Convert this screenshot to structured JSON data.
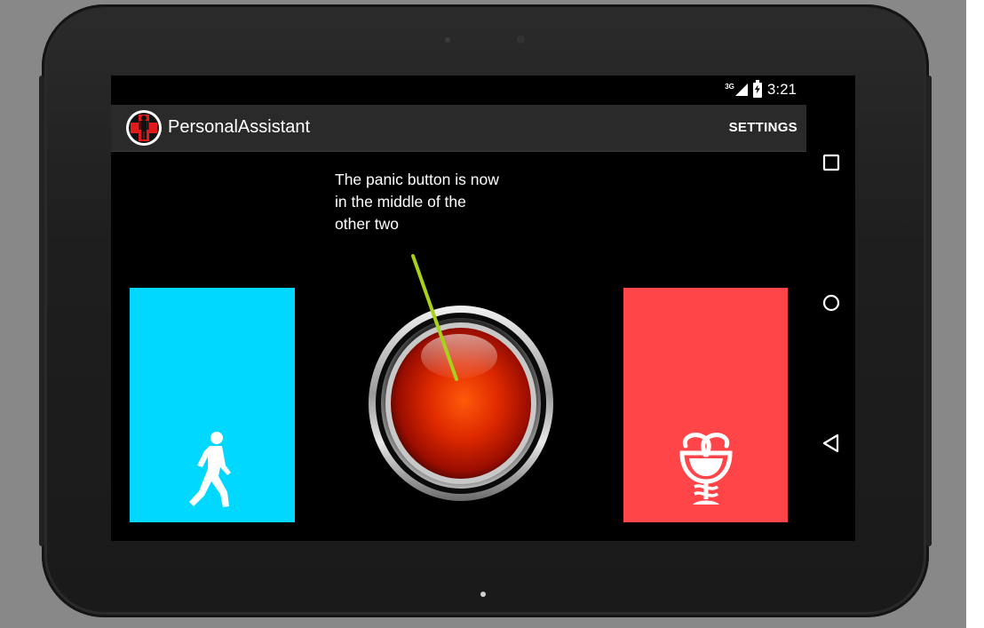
{
  "statusbar": {
    "network": "3G",
    "time": "3:21"
  },
  "actionbar": {
    "app_title": "PersonalAssistant",
    "settings_label": "SETTINGS",
    "logo_icon": "red-cross-person-icon"
  },
  "annotation": {
    "text_line1": "The panic button is now",
    "text_line2": "in the middle of the",
    "text_line3": "other two",
    "arrow_color": "#a8d21a"
  },
  "tiles": {
    "walk": {
      "icon": "walking-person-icon",
      "color": "#00d8ff"
    },
    "panic": {
      "icon": "red-panic-button-icon",
      "color": "#e02a00"
    },
    "medical": {
      "icon": "medical-caduceus-icon",
      "color": "#ff4548"
    }
  },
  "navbar": {
    "recent_icon": "recent-apps-square-icon",
    "home_icon": "home-circle-icon",
    "back_icon": "back-triangle-icon"
  }
}
